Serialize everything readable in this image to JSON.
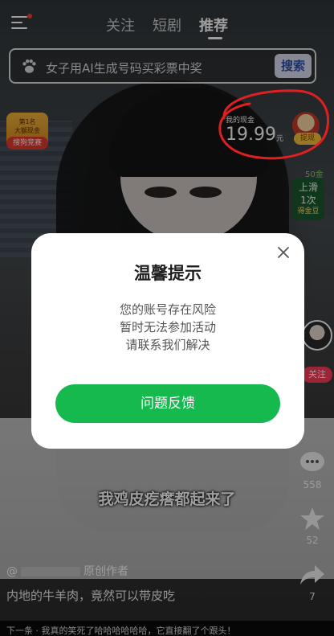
{
  "nav": {
    "tabs": [
      "关注",
      "短剧",
      "推荐"
    ],
    "active_tab": "推荐"
  },
  "search": {
    "query": "女子用AI生成号码买彩票中奖",
    "button_label": "搜索"
  },
  "rank_badge": {
    "line1": "第1名",
    "line2": "大额现金",
    "pill": "搜狗竞赛"
  },
  "cash": {
    "label": "我的现金",
    "amount": "19.99",
    "unit": "元",
    "withdraw_label": "提现"
  },
  "coin_widget": {
    "count": "50金",
    "line1": "上滑",
    "line2": "1次",
    "line3": "得金豆"
  },
  "right_rail": {
    "follow_label": "关注",
    "comment_count": "558",
    "favorite_count": "52",
    "share_count": "7"
  },
  "video": {
    "caption": "我鸡皮疙瘩都起来了",
    "author_prefix": "@",
    "author_suffix": "原创作者",
    "description": "内地的牛羊肉，竟然可以带皮吃",
    "next_up": "下一条 · 我真的笑死了哈哈哈哈哈哈，它直接翻了个跟头！"
  },
  "dialog": {
    "title": "温馨提示",
    "message_lines": [
      "您的账号存在风险",
      "暂时无法参加活动",
      "请联系我们解决"
    ],
    "button_label": "问题反馈"
  },
  "colors": {
    "primary_green": "#15b94d",
    "annotation_red": "#e02020",
    "follow_pink": "#fc3b5a"
  }
}
